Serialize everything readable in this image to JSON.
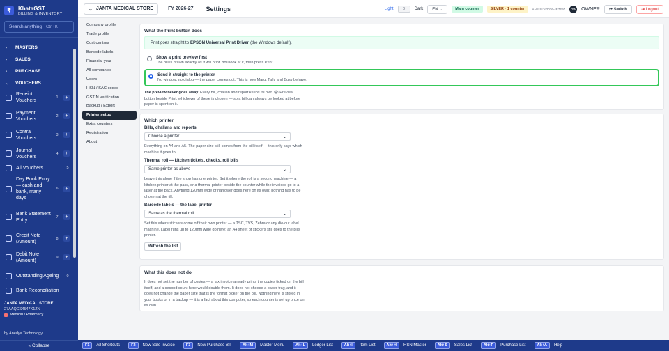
{
  "app": {
    "name": "KhataGST",
    "subtitle": "BILLING & INVENTORY",
    "logo_letter": "₹"
  },
  "sidebar": {
    "search_placeholder": "Search anything",
    "search_shortcut": "Ctrl+K",
    "groups": [
      {
        "label": "MASTERS",
        "chevron": "›"
      },
      {
        "label": "SALES",
        "chevron": "›"
      },
      {
        "label": "PURCHASE",
        "chevron": "›"
      },
      {
        "label": "VOUCHERS",
        "chevron": "⌄"
      }
    ],
    "items": [
      {
        "label": "Receipt Vouchers",
        "num": "1",
        "plus": "+"
      },
      {
        "label": "Payment Vouchers",
        "num": "2",
        "plus": "+"
      },
      {
        "label": "Contra Vouchers",
        "num": "3",
        "plus": "+"
      },
      {
        "label": "Journal Vouchers",
        "num": "4",
        "plus": "+"
      },
      {
        "label": "All Vouchers",
        "num": "5",
        "plus": ""
      },
      {
        "label": "Day Book Entry — cash and bank, many days",
        "num": "6",
        "plus": "+"
      },
      {
        "label": "Bank Statement Entry",
        "num": "7",
        "plus": "+"
      },
      {
        "label": "Credit Note (Amount)",
        "num": "8",
        "plus": "+"
      },
      {
        "label": "Debit Note (Amount)",
        "num": "9",
        "plus": "+"
      },
      {
        "label": "Outstanding Ageing",
        "num": "0",
        "plus": ""
      },
      {
        "label": "Bank Reconciliation",
        "num": "",
        "plus": ""
      }
    ],
    "company": {
      "name": "JANTA MEDICAL STORE",
      "gstin": "27AAQCS4547K1ZN",
      "type": "Medical / Pharmacy"
    },
    "by": "by Anedya Technology",
    "collapse": "« Collapse"
  },
  "header": {
    "firm": "JANTA MEDICAL STORE",
    "fy": "FY 2026-27",
    "title": "Settings",
    "light": "Light",
    "theme_value": "0",
    "dark": "Dark",
    "lang": "EN",
    "counter": "Main counter",
    "silver": "SILVER · 1 counter",
    "license": "ANS-SLV-2026-4E7F97",
    "avatar": "OW",
    "owner": "OWNER",
    "switch": "⇄ Switch",
    "logout": "⇥ Logout"
  },
  "settings_nav": [
    "Company profile",
    "Trade profile",
    "Cost centres",
    "Barcode labels",
    "Financial year",
    "All companies",
    "Users",
    "HSN / SAC codes",
    "GSTIN verification",
    "Backup / Export",
    "Printer setup",
    "Extra counters",
    "Registration",
    "About"
  ],
  "print_button": {
    "heading": "What the Print button does",
    "banner_pre": "Print goes straight to",
    "banner_printer": "EPSON Universal Print Driver",
    "banner_post": "(the Windows default).",
    "options": [
      {
        "title": "Show a print preview first",
        "desc": "The bill is drawn exactly as it will print. You look at it, then press Print.",
        "selected": false
      },
      {
        "title": "Send it straight to the printer",
        "desc": "No window, no dialog — the paper comes out. This is how Marg, Tally and Busy behave.",
        "selected": true
      }
    ],
    "note_bold": "The preview never goes away.",
    "note_text": "Every bill, challan and report keeps its own 👁 Preview button beside Print, whichever of these is chosen — so a bill can always be looked at before paper is spent on it."
  },
  "which_printer": {
    "heading": "Which printer",
    "bills_label": "Bills, challans and reports",
    "bills_value": "Choose a printer",
    "bills_help": "Everything on A4 and A5. The paper size still comes from the bill itself — this only says which machine it goes to.",
    "thermal_label": "Thermal roll — kitchen tickets, checks, roll bills",
    "thermal_value": "Same printer as above",
    "thermal_help": "Leave this alone if the shop has one printer. Set it where the roll is a second machine — a kitchen printer at the pass, or a thermal printer beside the counter while the invoices go to a laser at the back. Anything 120mm wide or narrower goes here on its own; nothing has to be chosen at the till.",
    "barcode_label": "Barcode labels — the label printer",
    "barcode_value": "Same as the thermal roll",
    "barcode_help": "Set this where stickers come off their own printer — a TSC, TVS, Zebra or any die-cut label machine. Label runs up to 120mm wide go here; an A4 sheet of stickers still goes to the bills printer.",
    "refresh": "Refresh the list"
  },
  "not_does": {
    "heading": "What this does not do",
    "text": "It does not set the number of copies — a tax invoice already prints the copies ticked on the bill itself, and a second count here would double them. It does not choose a paper tray, and it does not change the paper size that is the format picker on the bill. Nothing here is stored in your books or in a backup — it is a fact about this computer, so each counter is set up once on its own."
  },
  "shortcuts": [
    {
      "key": "F1",
      "label": "All Shortcuts"
    },
    {
      "key": "F2",
      "label": "New Sale Invoice"
    },
    {
      "key": "F3",
      "label": "New Purchase Bill"
    },
    {
      "key": "Alt+M",
      "label": "Master Menu"
    },
    {
      "key": "Alt+L",
      "label": "Ledger List"
    },
    {
      "key": "Alt+I",
      "label": "Item List"
    },
    {
      "key": "Alt+H",
      "label": "HSN Master"
    },
    {
      "key": "Alt+S",
      "label": "Sales List"
    },
    {
      "key": "Alt+P",
      "label": "Purchase List"
    },
    {
      "key": "Alt+A",
      "label": "Help"
    }
  ]
}
